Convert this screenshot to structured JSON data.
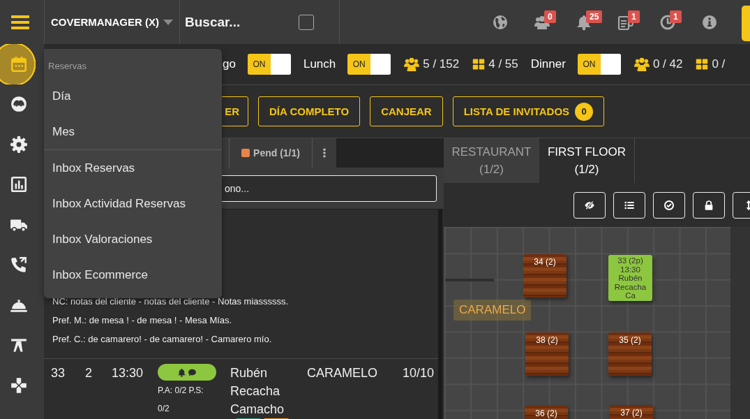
{
  "sidebar": {
    "items": [
      {
        "kind": "calendar",
        "selected": true
      },
      {
        "kind": "face",
        "selected": false
      },
      {
        "kind": "gear",
        "selected": false
      },
      {
        "kind": "chart",
        "selected": false
      },
      {
        "kind": "truck",
        "selected": false
      },
      {
        "kind": "phone",
        "selected": false
      },
      {
        "kind": "cloche",
        "selected": false
      },
      {
        "kind": "table",
        "selected": false
      },
      {
        "kind": "cross",
        "selected": false
      }
    ]
  },
  "header": {
    "brand": "COVERMANAGER (X)",
    "search": {
      "placeholder": "Buscar..."
    },
    "search_checkbox": {
      "checked": false
    },
    "notifications": [
      {
        "kind": "globe"
      },
      {
        "kind": "people",
        "badge": "0"
      },
      {
        "kind": "bell",
        "badge": "25"
      },
      {
        "kind": "clipboard",
        "badge": "1"
      },
      {
        "kind": "clock",
        "badge": "1"
      },
      {
        "kind": "info"
      }
    ]
  },
  "menu": {
    "title": "Reservas",
    "groups": [
      [
        "Día",
        "Mes"
      ],
      [
        "Inbox Reservas",
        "Inbox Actividad Reservas",
        "Inbox Valoraciones",
        "Inbox Ecommerce"
      ]
    ]
  },
  "services": [
    {
      "label": "go",
      "toggle": {
        "text": "ON",
        "on": true
      }
    },
    {
      "label": "Lunch",
      "toggle": {
        "text": "ON",
        "on": true
      },
      "covers": "5 / 152",
      "tables": "4 / 55"
    },
    {
      "label": "Dinner",
      "toggle": {
        "text": "ON",
        "on": true
      },
      "covers": "0 / 42",
      "tables": "0 /"
    }
  ],
  "actions": [
    {
      "label": "ER"
    },
    {
      "label": "DÍA COMPLETO"
    },
    {
      "label": "CANJEAR"
    },
    {
      "label": "LISTA DE INVITADOS",
      "badge": "0"
    }
  ],
  "list": {
    "tabs": [
      {
        "label": "Pend (1/1)",
        "color": "#e8834a"
      }
    ],
    "search": {
      "placeholder": "ono..."
    },
    "notes": [
      "NC: notas del cliente - notas del cliente - Notas miassssss.",
      "Pref. M.: de mesa ! - de mesa ! - Mesa Mías.",
      "Pref. C.: de camarero! - de camarero! - Camarero mío."
    ],
    "rows": [
      {
        "table": "33",
        "pax": "2",
        "time": "13:30",
        "status": {
          "color": "#8dc63f"
        },
        "payment": "P.A: 0/2 P.S: 0/2",
        "name": "Rubén Recacha Camacho",
        "zone": "CARAMELO",
        "date": "10/10",
        "tags": [
          {
            "color": "#2e9e7e"
          },
          {
            "color": "#f0901e"
          }
        ]
      }
    ]
  },
  "floor": {
    "tabs": [
      {
        "name": "RESTAURANT",
        "count": "(1/2)",
        "selected": false
      },
      {
        "name": "FIRST FLOOR",
        "count": "(1/2)",
        "selected": true
      }
    ],
    "tools": [
      {
        "kind": "hide"
      },
      {
        "kind": "list"
      },
      {
        "kind": "check"
      },
      {
        "kind": "lock"
      },
      {
        "kind": "resize"
      }
    ],
    "zone_label": "CARAMELO",
    "tables": [
      {
        "kind": "free",
        "lines": [
          "34 (2)"
        ]
      },
      {
        "kind": "booked",
        "lines": [
          "33 (2p)",
          "13:30",
          "Rubén",
          "Recacha",
          "Ca"
        ]
      },
      {
        "kind": "free",
        "lines": [
          "38 (2)"
        ]
      },
      {
        "kind": "free",
        "lines": [
          "35 (2)"
        ]
      },
      {
        "kind": "free",
        "lines": [
          "36 (2)"
        ]
      },
      {
        "kind": "free",
        "lines": [
          "37 (2)"
        ]
      }
    ]
  }
}
